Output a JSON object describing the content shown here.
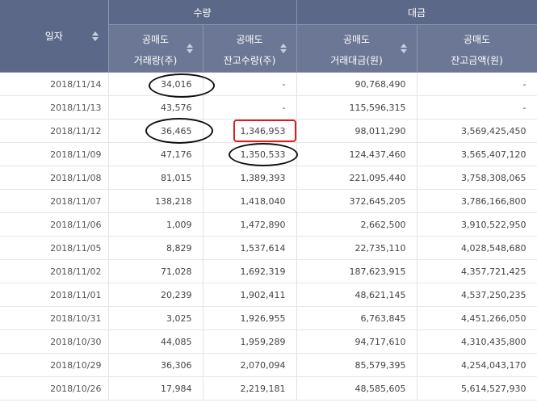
{
  "header": {
    "date_label": "일자",
    "group_qty": "수량",
    "group_amt": "대금",
    "cols": [
      {
        "line1": "공매도",
        "line2": "거래량(주)"
      },
      {
        "line1": "공매도",
        "line2": "잔고수량(주)"
      },
      {
        "line1": "공매도",
        "line2": "거래대금(원)"
      },
      {
        "line1": "공매도",
        "line2": "잔고금액(원)"
      }
    ]
  },
  "rows": [
    {
      "date": "2018/11/14",
      "vol": "34,016",
      "bal_qty": "-",
      "amount": "90,768,490",
      "bal_amt": "-"
    },
    {
      "date": "2018/11/13",
      "vol": "43,576",
      "bal_qty": "-",
      "amount": "115,596,315",
      "bal_amt": "-"
    },
    {
      "date": "2018/11/12",
      "vol": "36,465",
      "bal_qty": "1,346,953",
      "amount": "98,011,290",
      "bal_amt": "3,569,425,450"
    },
    {
      "date": "2018/11/09",
      "vol": "47,176",
      "bal_qty": "1,350,533",
      "amount": "124,437,460",
      "bal_amt": "3,565,407,120"
    },
    {
      "date": "2018/11/08",
      "vol": "81,015",
      "bal_qty": "1,389,393",
      "amount": "221,095,440",
      "bal_amt": "3,758,308,065"
    },
    {
      "date": "2018/11/07",
      "vol": "138,218",
      "bal_qty": "1,418,040",
      "amount": "372,645,205",
      "bal_amt": "3,786,166,800"
    },
    {
      "date": "2018/11/06",
      "vol": "1,009",
      "bal_qty": "1,472,890",
      "amount": "2,662,500",
      "bal_amt": "3,910,522,950"
    },
    {
      "date": "2018/11/05",
      "vol": "8,829",
      "bal_qty": "1,537,614",
      "amount": "22,735,110",
      "bal_amt": "4,028,548,680"
    },
    {
      "date": "2018/11/02",
      "vol": "71,028",
      "bal_qty": "1,692,319",
      "amount": "187,623,915",
      "bal_amt": "4,357,721,425"
    },
    {
      "date": "2018/11/01",
      "vol": "20,239",
      "bal_qty": "1,902,411",
      "amount": "48,621,145",
      "bal_amt": "4,537,250,235"
    },
    {
      "date": "2018/10/31",
      "vol": "3,025",
      "bal_qty": "1,926,955",
      "amount": "6,763,845",
      "bal_amt": "4,451,266,050"
    },
    {
      "date": "2018/10/30",
      "vol": "44,085",
      "bal_qty": "1,959,289",
      "amount": "94,717,610",
      "bal_amt": "4,310,435,800"
    },
    {
      "date": "2018/10/29",
      "vol": "36,306",
      "bal_qty": "2,070,094",
      "amount": "85,579,395",
      "bal_amt": "4,254,043,170"
    },
    {
      "date": "2018/10/26",
      "vol": "17,984",
      "bal_qty": "2,219,181",
      "amount": "48,585,605",
      "bal_amt": "5,614,527,930"
    }
  ],
  "annotations": {
    "oval_color": "#111111",
    "rect_color": "#d81e1e"
  }
}
